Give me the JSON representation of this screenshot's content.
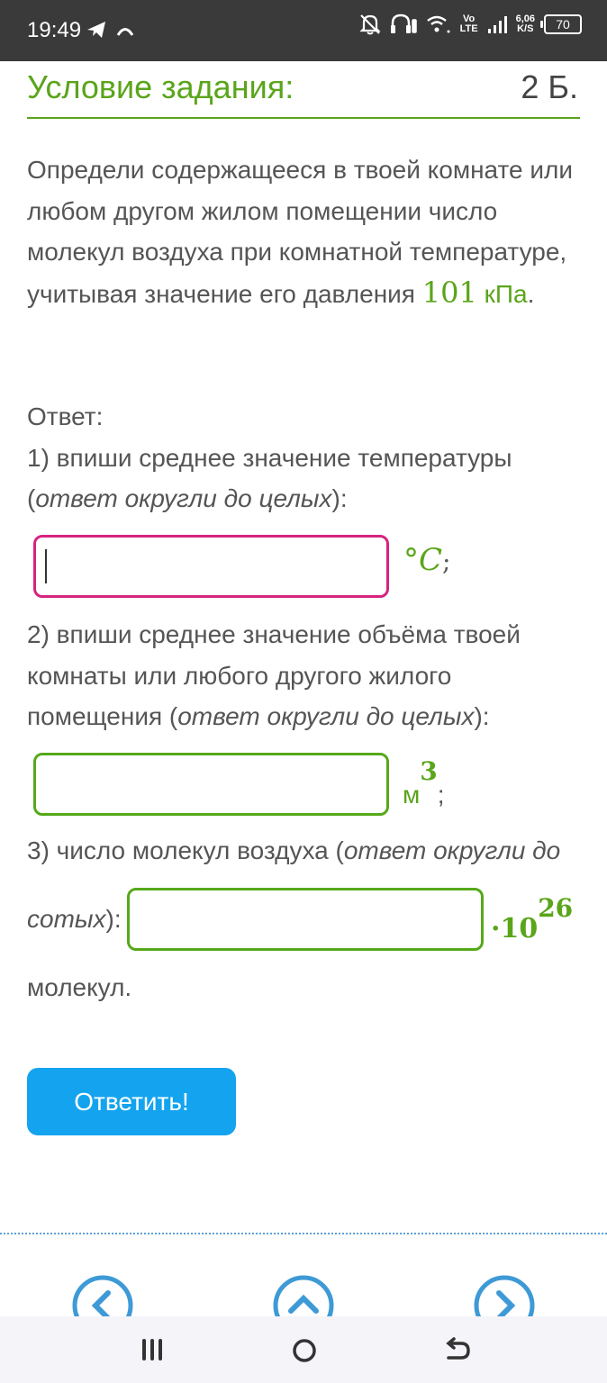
{
  "status_bar": {
    "time": "19:49",
    "net_type_top": "Vo",
    "net_type_bottom": "LTE",
    "speed_value": "6,06",
    "speed_unit": "K/S",
    "battery": "70"
  },
  "task": {
    "title": "Условие задания:",
    "points": "2 Б.",
    "condition_text": "Определи содержащееся в твоей комнате или любом другом жилом помещении число молекул воздуха при комнатной температуре, учитывая значение его давления",
    "pressure_value": "101",
    "pressure_unit": "кПа",
    "pressure_end": ".",
    "answer_label": "Ответ:",
    "q1_text": "1) впиши среднее значение температуры (",
    "q1_hint": "ответ округли до целых",
    "q1_end": "):",
    "q1_unit": "°C",
    "q1_sep": ";",
    "q2_text": "2) впиши среднее значение объёма твоей комнаты или любого другого жилого помещения (",
    "q2_hint": "ответ округли до целых",
    "q2_end": "):",
    "q2_unit": "м",
    "q2_power": "3",
    "q2_sep": ";",
    "q3_text": "3) число молекул воздуха (",
    "q3_hint1": "ответ округли до",
    "q3_hint2": "сотых",
    "q3_end": "):",
    "q3_mult": "·10",
    "q3_power": "26",
    "q3_tail": "молекул.",
    "submit_label": "Ответить!"
  },
  "colors": {
    "accent_green": "#5aa51a",
    "active_border": "#d6237f",
    "button_blue": "#14a4ef",
    "nav_circle": "#3e9ad6"
  },
  "icons": [
    "telegram-icon",
    "bell-off-icon",
    "headphones-icon",
    "wifi-icon",
    "signal-icon",
    "chevron-left-icon",
    "chevron-up-icon",
    "chevron-right-icon",
    "menu-icon",
    "home-icon",
    "back-icon"
  ]
}
